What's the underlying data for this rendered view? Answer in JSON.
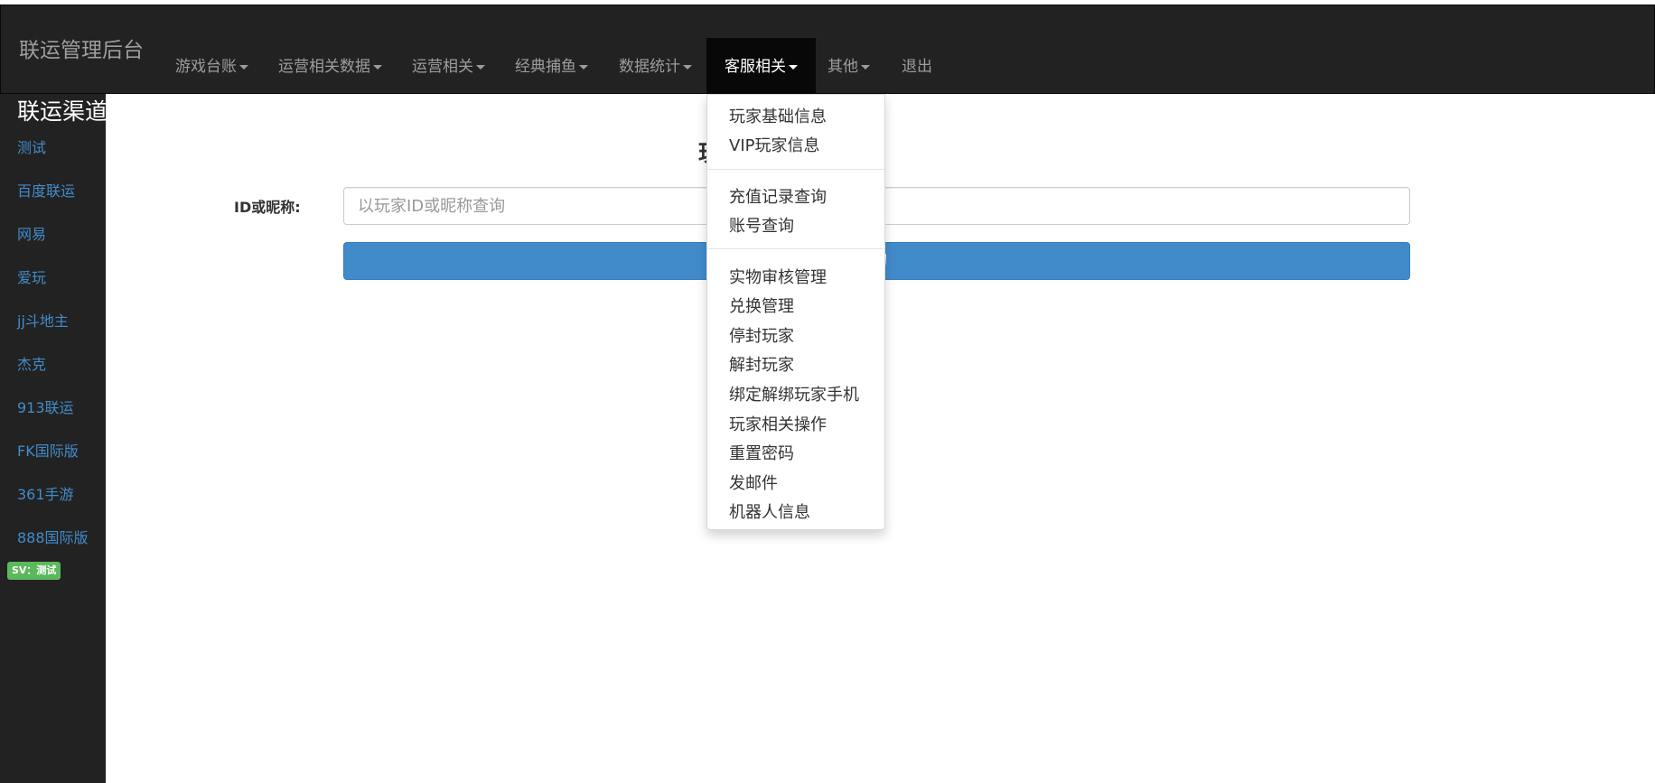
{
  "navbar": {
    "brand": "联运管理后台",
    "items": [
      {
        "label": "游戏台账"
      },
      {
        "label": "运营相关数据"
      },
      {
        "label": "运营相关"
      },
      {
        "label": "经典捕鱼"
      },
      {
        "label": "数据统计"
      },
      {
        "label": "客服相关"
      },
      {
        "label": "其他"
      },
      {
        "label": "退出"
      }
    ],
    "active_item": "客服相关"
  },
  "sidebar": {
    "title": "联运渠道",
    "links": [
      {
        "label": "测试"
      },
      {
        "label": "百度联运"
      },
      {
        "label": "网易"
      },
      {
        "label": "爱玩"
      },
      {
        "label": "jj斗地主"
      },
      {
        "label": "杰克"
      },
      {
        "label": "913联运"
      },
      {
        "label": "FK国际版"
      },
      {
        "label": "361手游"
      },
      {
        "label": "888国际版"
      }
    ],
    "badge": "SV：测试"
  },
  "main": {
    "heading_partial": "玩",
    "form": {
      "label": "ID或昵称:",
      "input_value": "",
      "input_placeholder": "以玩家ID或昵称查询",
      "button_partial_label": "询"
    }
  },
  "dropdown": {
    "groups": [
      [
        {
          "label": "玩家基础信息"
        },
        {
          "label": "VIP玩家信息"
        }
      ],
      [
        {
          "label": "充值记录查询"
        },
        {
          "label": "账号查询"
        }
      ],
      [
        {
          "label": "实物审核管理"
        },
        {
          "label": "兑换管理"
        },
        {
          "label": "停封玩家"
        },
        {
          "label": "解封玩家"
        },
        {
          "label": "绑定解绑玩家手机"
        },
        {
          "label": "玩家相关操作"
        },
        {
          "label": "重置密码"
        },
        {
          "label": "发邮件"
        },
        {
          "label": "机器人信息"
        }
      ]
    ]
  },
  "colors": {
    "navbar_bg": "#222222",
    "active_nav_bg": "#080808",
    "link": "#428bca",
    "primary_button": "#428bca",
    "badge": "#5cb85c"
  }
}
